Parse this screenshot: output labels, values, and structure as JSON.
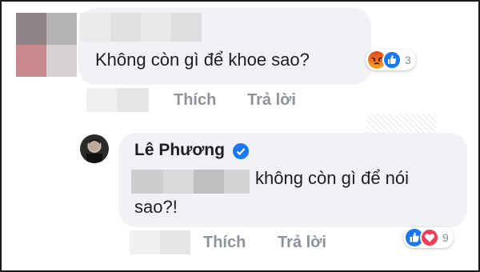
{
  "comment1": {
    "text": "Không còn gì để khoe sao?",
    "reaction_icons": [
      "angry-icon",
      "like-icon"
    ],
    "reaction_count": "3",
    "actions": {
      "like": "Thích",
      "reply": "Trả lời"
    }
  },
  "reply1": {
    "author": "Lê Phương",
    "verified_icon": "verified-badge-icon",
    "text_line1": "không còn gì để nói",
    "text_line2": "sao?!",
    "reaction_icons": [
      "like-icon",
      "love-icon"
    ],
    "reaction_count": "9",
    "actions": {
      "like": "Thích",
      "reply": "Trả lời"
    }
  },
  "colors": {
    "bubble": "#f0f2f5",
    "like_blue": "#1877f2",
    "love_red": "#f33e58",
    "angry_orange": "#e9710f",
    "verified_blue": "#1877f2",
    "action_gray": "#8e9299"
  }
}
